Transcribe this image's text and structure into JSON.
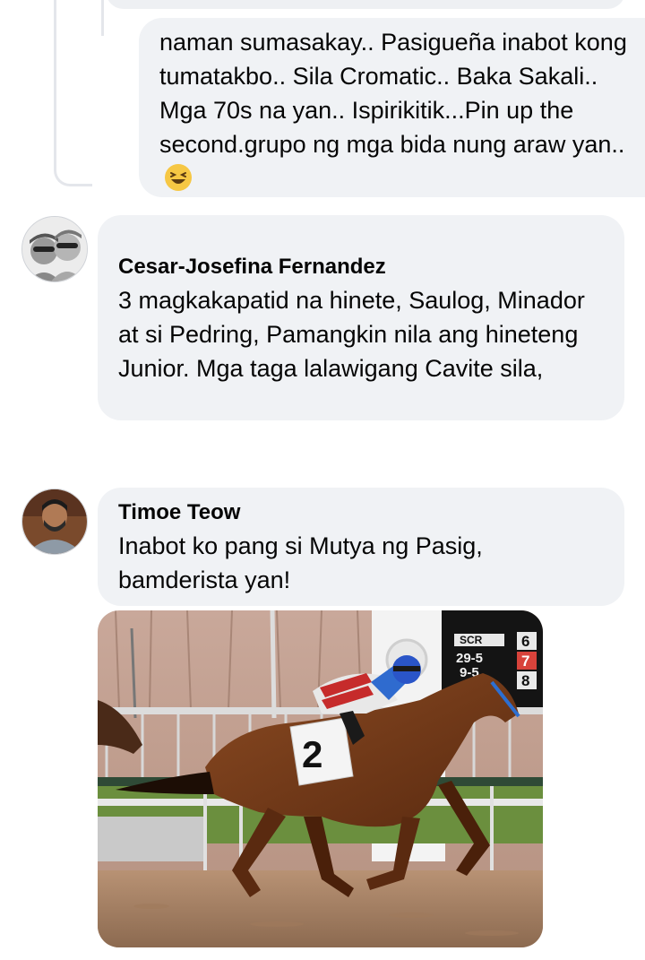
{
  "comments": [
    {
      "text": "naman sumasakay.. Pasigueña inabot kong tumatakbo.. Sila Cromatic.. Baka Sakali.. Mga 70s na yan.. Ispirikitik...Pin up the second.grupo ng mga bida nung araw yan..",
      "emoji": "laughing-face"
    },
    {
      "author": "Cesar-Josefina Fernandez",
      "text": "3 magkakapatid na hinete, Saulog, Minador at si Pedring,  Pamangkin nila ang hineteng Junior.  Mga taga lalawigang Cavite sila,"
    },
    {
      "author": "Timoe Teow",
      "text": "Inabot ko pang si Mutya ng Pasig, bamderista yan!",
      "attachment": {
        "type": "photo",
        "saddle_number": "2",
        "scoreboard": {
          "scr": "SCR",
          "row1": "29-5",
          "row2": "9-5",
          "digits": [
            "6",
            "7",
            "8"
          ]
        }
      }
    }
  ],
  "colors": {
    "bubble": "#f0f2f5",
    "text": "#050505",
    "thread_line": "#e4e6eb"
  }
}
